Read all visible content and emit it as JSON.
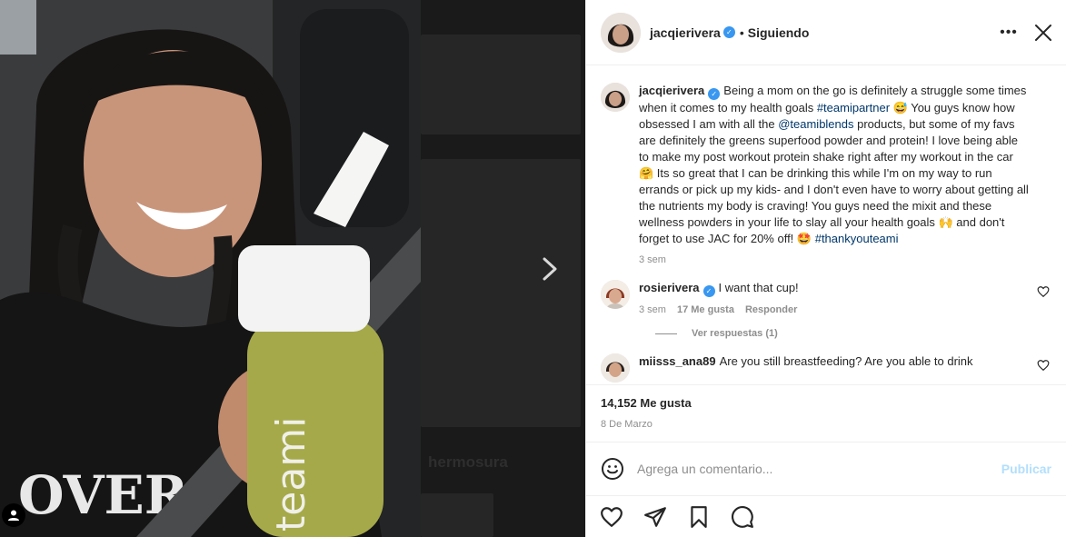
{
  "header": {
    "username": "jacqierivera",
    "dot": "•",
    "following_label": "Siguiendo",
    "more_icon": "more-horizontal-icon",
    "close_icon": "close-icon"
  },
  "caption": {
    "username": "jacqierivera",
    "text_1": "Being a mom on the go is definitely a struggle some times when it comes to my health goals ",
    "hashtag_1": "#teamipartner",
    "text_2": " 😅 You guys know how obsessed I am with all the ",
    "mention": "@teamiblends",
    "text_3": " products, but some of my favs are definitely the greens superfood powder and protein! I love being able to make my post workout protein shake right after my workout in the car 🤗 Its so great that I can be drinking this while I'm on my way to run errands or pick up my kids- and I don't even have to worry about getting all the nutrients my body is craving! You guys need the mixit and these wellness powders in your life to slay all your health goals 🙌 and don't forget to use JAC for 20% off! 🤩 ",
    "hashtag_2": "#thankyouteami",
    "time": "3 sem"
  },
  "comments": [
    {
      "username": "rosierivera",
      "text": "I want that cup!",
      "time": "3 sem",
      "likes": "17 Me gusta",
      "reply_label": "Responder",
      "view_replies": "Ver respuestas (1)"
    },
    {
      "username": "miisss_ana89",
      "text": "Are you still breastfeeding? Are you able to drink"
    }
  ],
  "post": {
    "likes": "14,152 Me gusta",
    "date": "8 De Marzo"
  },
  "comment_box": {
    "placeholder": "Agrega un comentario...",
    "publish_label": "Publicar"
  },
  "backdrop": {
    "text": "hermosura"
  },
  "colors": {
    "verified": "#3897f0",
    "link": "#00376b",
    "publish_disabled": "#b2dffc",
    "muted": "#8e8e8e"
  }
}
